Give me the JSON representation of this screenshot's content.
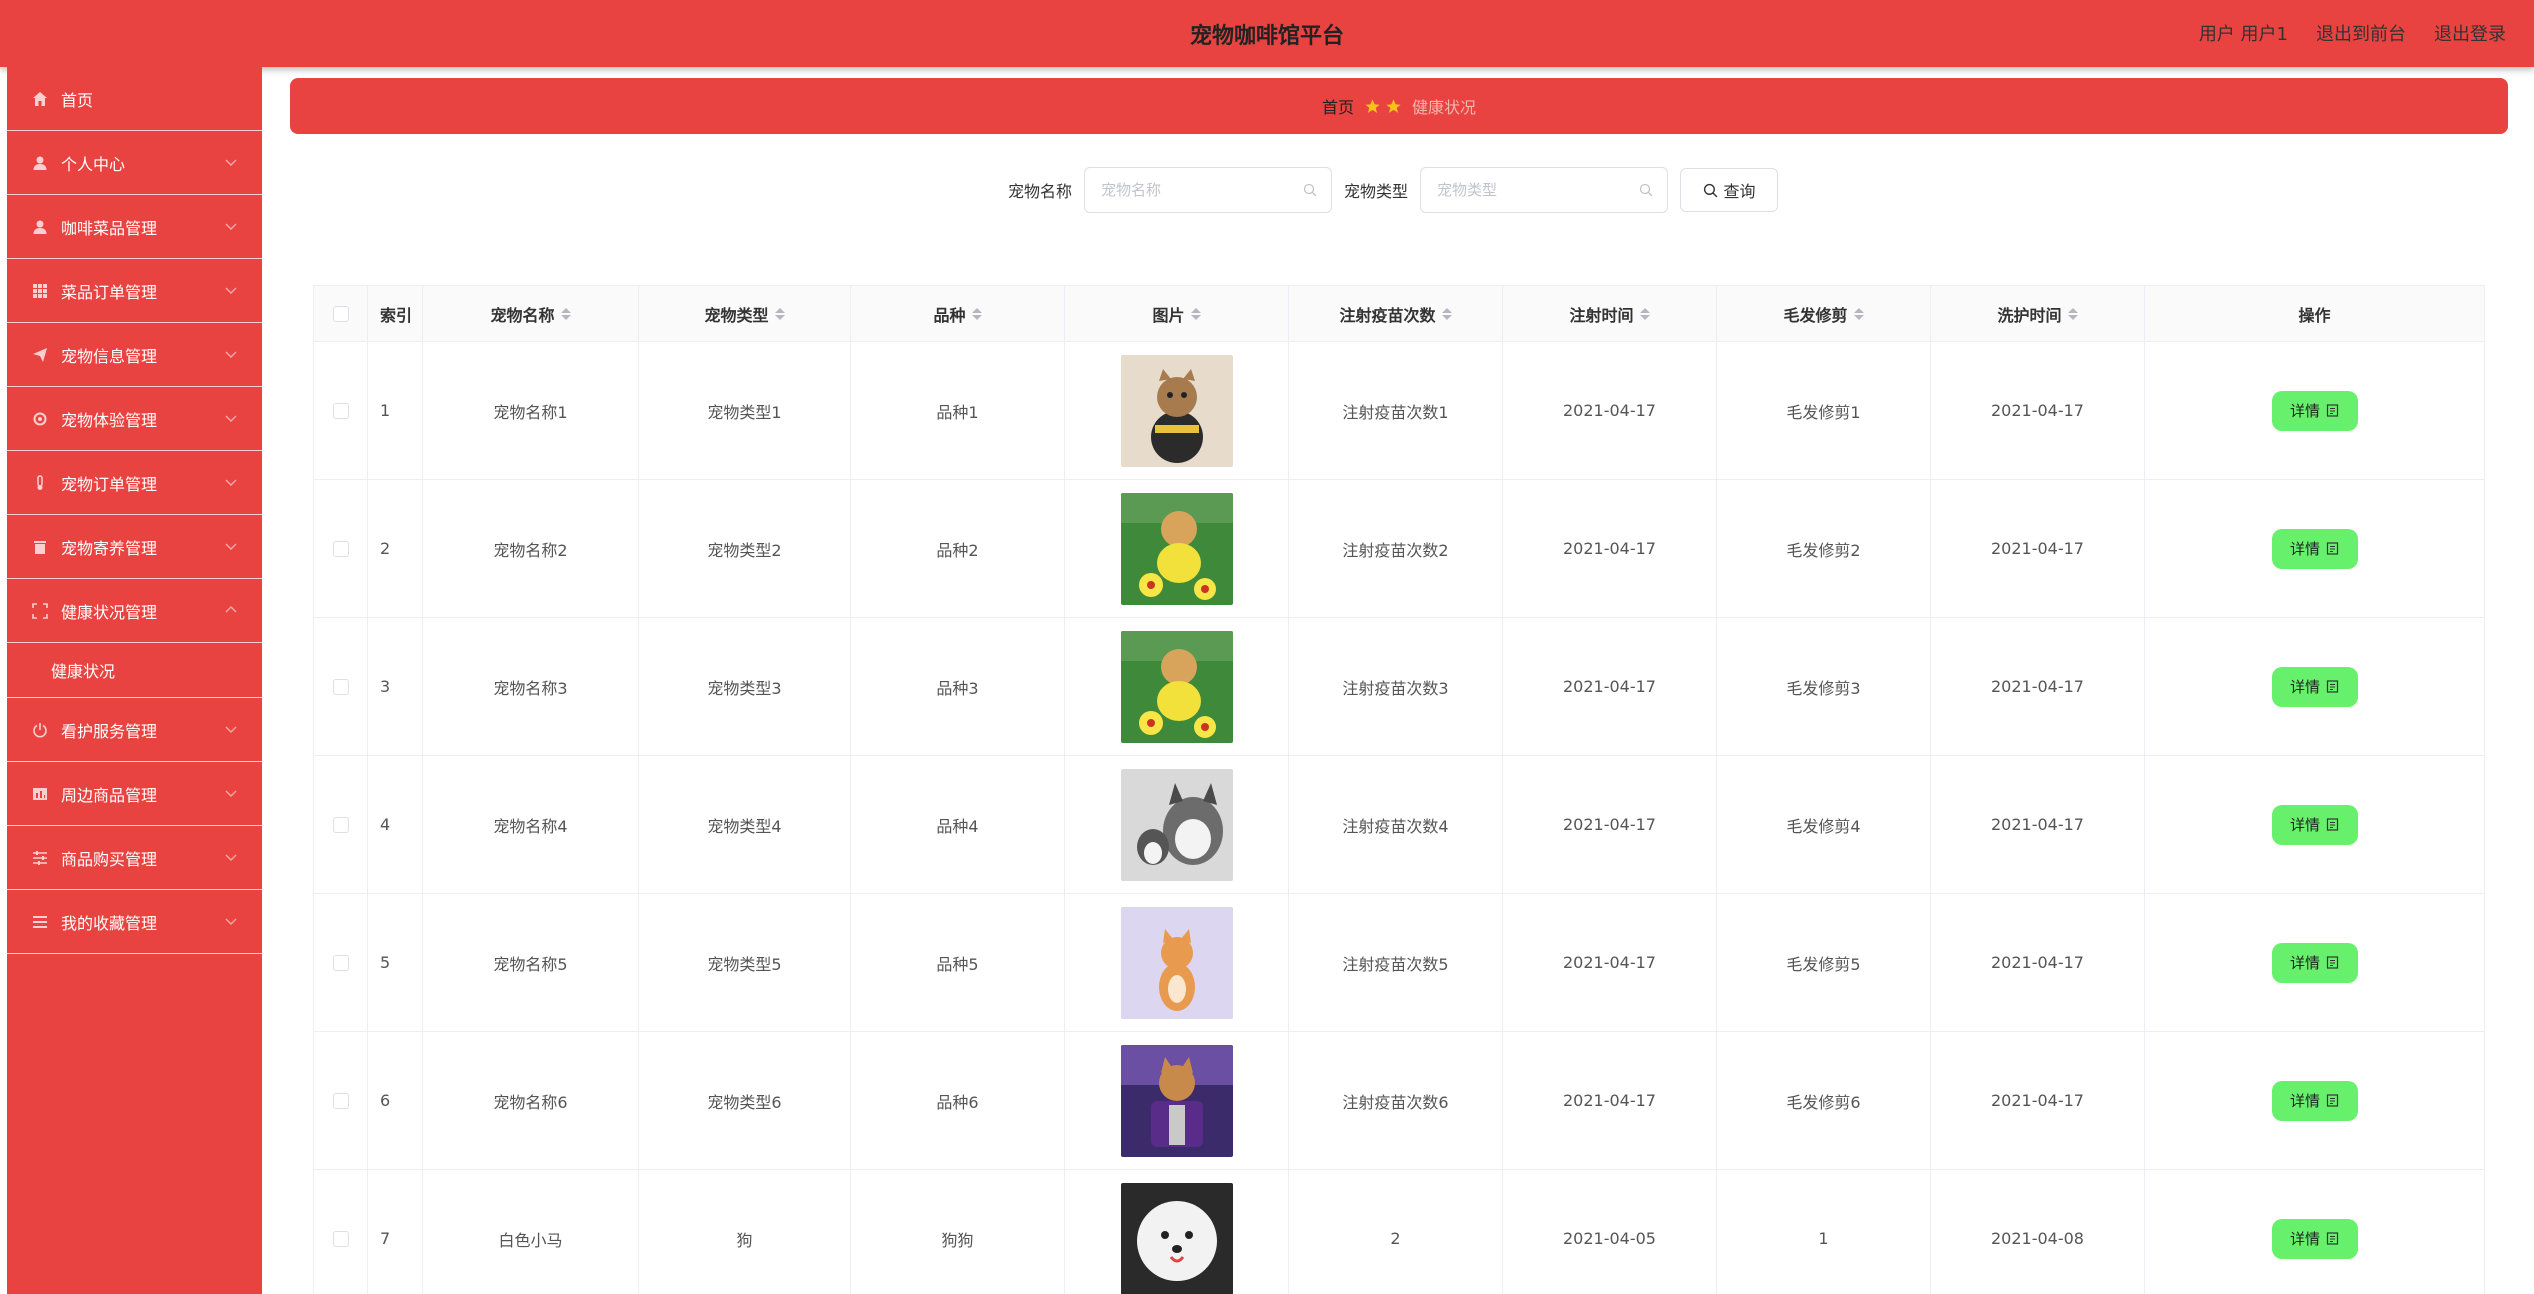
{
  "app": {
    "title": "宠物咖啡馆平台",
    "user_label": "用户 用户1",
    "to_front_label": "退出到前台",
    "logout_label": "退出登录"
  },
  "sidebar": {
    "items": [
      {
        "label": "首页",
        "icon": "home-icon"
      },
      {
        "label": "个人中心",
        "icon": "user-icon"
      },
      {
        "label": "咖啡菜品管理",
        "icon": "user-icon"
      },
      {
        "label": "菜品订单管理",
        "icon": "grid-icon"
      },
      {
        "label": "宠物信息管理",
        "icon": "send-icon"
      },
      {
        "label": "宠物体验管理",
        "icon": "gear-icon"
      },
      {
        "label": "宠物订单管理",
        "icon": "thermometer-icon"
      },
      {
        "label": "宠物寄养管理",
        "icon": "trash-icon"
      },
      {
        "label": "健康状况管理",
        "icon": "fullscreen-icon"
      },
      {
        "label": "看护服务管理",
        "icon": "power-icon"
      },
      {
        "label": "周边商品管理",
        "icon": "chart-icon"
      },
      {
        "label": "商品购买管理",
        "icon": "sliders-icon"
      },
      {
        "label": "我的收藏管理",
        "icon": "list-icon"
      }
    ],
    "submenu": {
      "label": "健康状况"
    }
  },
  "breadcrumb": {
    "home": "首页",
    "current": "健康状况"
  },
  "search": {
    "name_label": "宠物名称",
    "name_placeholder": "宠物名称",
    "type_label": "宠物类型",
    "type_placeholder": "宠物类型",
    "query_label": "查询"
  },
  "table": {
    "headers": [
      "索引",
      "宠物名称",
      "宠物类型",
      "品种",
      "图片",
      "注射疫苗次数",
      "注射时间",
      "毛发修剪",
      "洗护时间",
      "操作"
    ],
    "detail_label": "详情",
    "rows": [
      {
        "index": "1",
        "name": "宠物名称1",
        "type": "宠物类型1",
        "breed": "品种1",
        "vaccines": "注射疫苗次数1",
        "inject_time": "2021-04-17",
        "trim": "毛发修剪1",
        "wash_time": "2021-04-17",
        "photo": "cat-in-costume"
      },
      {
        "index": "2",
        "name": "宠物名称2",
        "type": "宠物类型2",
        "breed": "品种2",
        "vaccines": "注射疫苗次数2",
        "inject_time": "2021-04-17",
        "trim": "毛发修剪2",
        "wash_time": "2021-04-17",
        "photo": "dog-with-football"
      },
      {
        "index": "3",
        "name": "宠物名称3",
        "type": "宠物类型3",
        "breed": "品种3",
        "vaccines": "注射疫苗次数3",
        "inject_time": "2021-04-17",
        "trim": "毛发修剪3",
        "wash_time": "2021-04-17",
        "photo": "dog-with-football"
      },
      {
        "index": "4",
        "name": "宠物名称4",
        "type": "宠物类型4",
        "breed": "品种4",
        "vaccines": "注射疫苗次数4",
        "inject_time": "2021-04-17",
        "trim": "毛发修剪4",
        "wash_time": "2021-04-17",
        "photo": "husky-and-puppy"
      },
      {
        "index": "5",
        "name": "宠物名称5",
        "type": "宠物类型5",
        "breed": "品种5",
        "vaccines": "注射疫苗次数5",
        "inject_time": "2021-04-17",
        "trim": "毛发修剪5",
        "wash_time": "2021-04-17",
        "photo": "orange-kitten"
      },
      {
        "index": "6",
        "name": "宠物名称6",
        "type": "宠物类型6",
        "breed": "品种6",
        "vaccines": "注射疫苗次数6",
        "inject_time": "2021-04-17",
        "trim": "毛发修剪6",
        "wash_time": "2021-04-17",
        "photo": "cat-in-purple-box"
      },
      {
        "index": "7",
        "name": "白色小马",
        "type": "狗",
        "breed": "狗狗",
        "vaccines": "2",
        "inject_time": "2021-04-05",
        "trim": "1",
        "wash_time": "2021-04-08",
        "photo": "white-samoyed"
      }
    ]
  },
  "colors": {
    "brand": "#e84340",
    "detail_button": "#67f06c",
    "star": "#f7c21b"
  }
}
